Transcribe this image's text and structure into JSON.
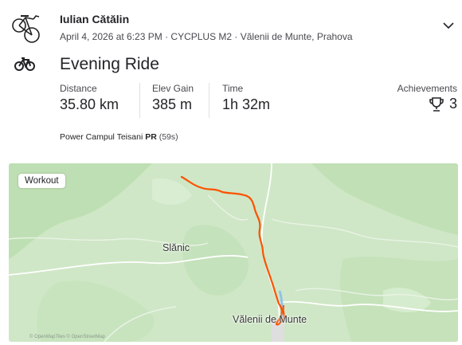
{
  "athlete": {
    "name": "Iulian Cătălin",
    "avatar_icon": "road-bike-avatar"
  },
  "activity": {
    "meta": "April 4, 2026 at 6:23 PM · CYCPLUS M2 · Vălenii de Munte, Prahova",
    "sport_icon": "bike-icon",
    "title": "Evening Ride"
  },
  "stats": {
    "distance": {
      "label": "Distance",
      "value": "35.80 km"
    },
    "elev_gain": {
      "label": "Elev Gain",
      "value": "385 m"
    },
    "time": {
      "label": "Time",
      "value": "1h 32m"
    },
    "achievements": {
      "label": "Achievements",
      "value": "3",
      "icon": "trophy-icon"
    }
  },
  "segment": {
    "name": "Power Campul Teisani",
    "badge": "PR",
    "time": "(59s)"
  },
  "map": {
    "badge": "Workout",
    "place_labels": [
      "Slănic",
      "Vălenii de Munte"
    ],
    "attribution": "© OpenMapTiles © OpenStreetMap",
    "route_color": "#fc5200"
  }
}
